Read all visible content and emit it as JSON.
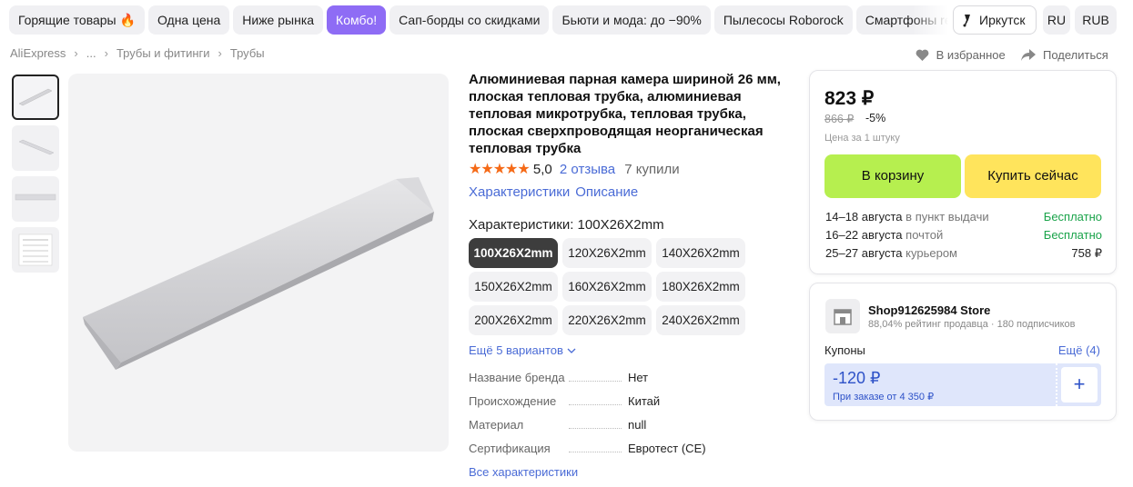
{
  "topnav": {
    "chips": [
      "Горящие товары 🔥",
      "Одна цена",
      "Ниже рынка",
      "Комбо!",
      "Сап-борды со скидками",
      "Бьюти и мода: до −90%",
      "Пылесосы Roborock",
      "Смартфоны realme"
    ],
    "active_chip_index": 3,
    "location": "Иркутск",
    "language": "RU",
    "currency": "RUB"
  },
  "breadcrumb": {
    "items": [
      "AliExpress",
      "...",
      "Трубы и фитинги",
      "Трубы"
    ]
  },
  "actions": {
    "favorite": "В избранное",
    "share": "Поделиться"
  },
  "product": {
    "title": "Алюминиевая парная камера шириной 26 мм, плоская тепловая трубка, алюминиевая тепловая микротрубка, тепловая трубка, плоская сверхпроводящая неорганическая тепловая трубка",
    "stars": "★★★★★",
    "rating": "5,0",
    "reviews": "2 отзыва",
    "bought": "7 купили",
    "tabs": [
      "Характеристики",
      "Описание"
    ],
    "characteristic_label": "Характеристики: 100X26X2mm",
    "variants": [
      "100X26X2mm",
      "120X26X2mm",
      "140X26X2mm",
      "150X26X2mm",
      "160X26X2mm",
      "180X26X2mm",
      "200X26X2mm",
      "220X26X2mm",
      "240X26X2mm"
    ],
    "selected_variant": 0,
    "more_variants": "Ещё 5 вариантов",
    "specs": [
      {
        "key": "Название бренда",
        "value": "Нет"
      },
      {
        "key": "Происхождение",
        "value": "Китай"
      },
      {
        "key": "Материал",
        "value": "null"
      },
      {
        "key": "Сертификация",
        "value": "Евротест (CE)"
      }
    ],
    "all_specs": "Все характеристики"
  },
  "buybox": {
    "price": "823 ₽",
    "old_price": "866 ₽",
    "discount": "-5%",
    "unit_note": "Цена за 1 штуку",
    "cart_button": "В корзину",
    "buy_button": "Купить сейчас",
    "delivery": [
      {
        "dates": "14–18 августа",
        "method": "в пункт выдачи",
        "price": "Бесплатно",
        "free": true
      },
      {
        "dates": "16–22 августа",
        "method": "почтой",
        "price": "Бесплатно",
        "free": true
      },
      {
        "dates": "25–27 августа",
        "method": "курьером",
        "price": "758 ₽",
        "free": false
      }
    ]
  },
  "store": {
    "name": "Shop912625984 Store",
    "rating": "88,04% рейтинг продавца",
    "subscribers": "180 подписчиков",
    "coupons_label": "Купоны",
    "coupons_more": "Ещё (4)",
    "coupon_value": "-120 ₽",
    "coupon_min": "При заказе от 4 350 ₽"
  },
  "colors": {
    "accent_purple": "#8e6cf5",
    "cart_green": "#b6ef4f",
    "buy_yellow": "#ffe45c",
    "link_blue": "#4a6bd6",
    "star_orange": "#f56a17",
    "free_green": "#1aa34a"
  }
}
